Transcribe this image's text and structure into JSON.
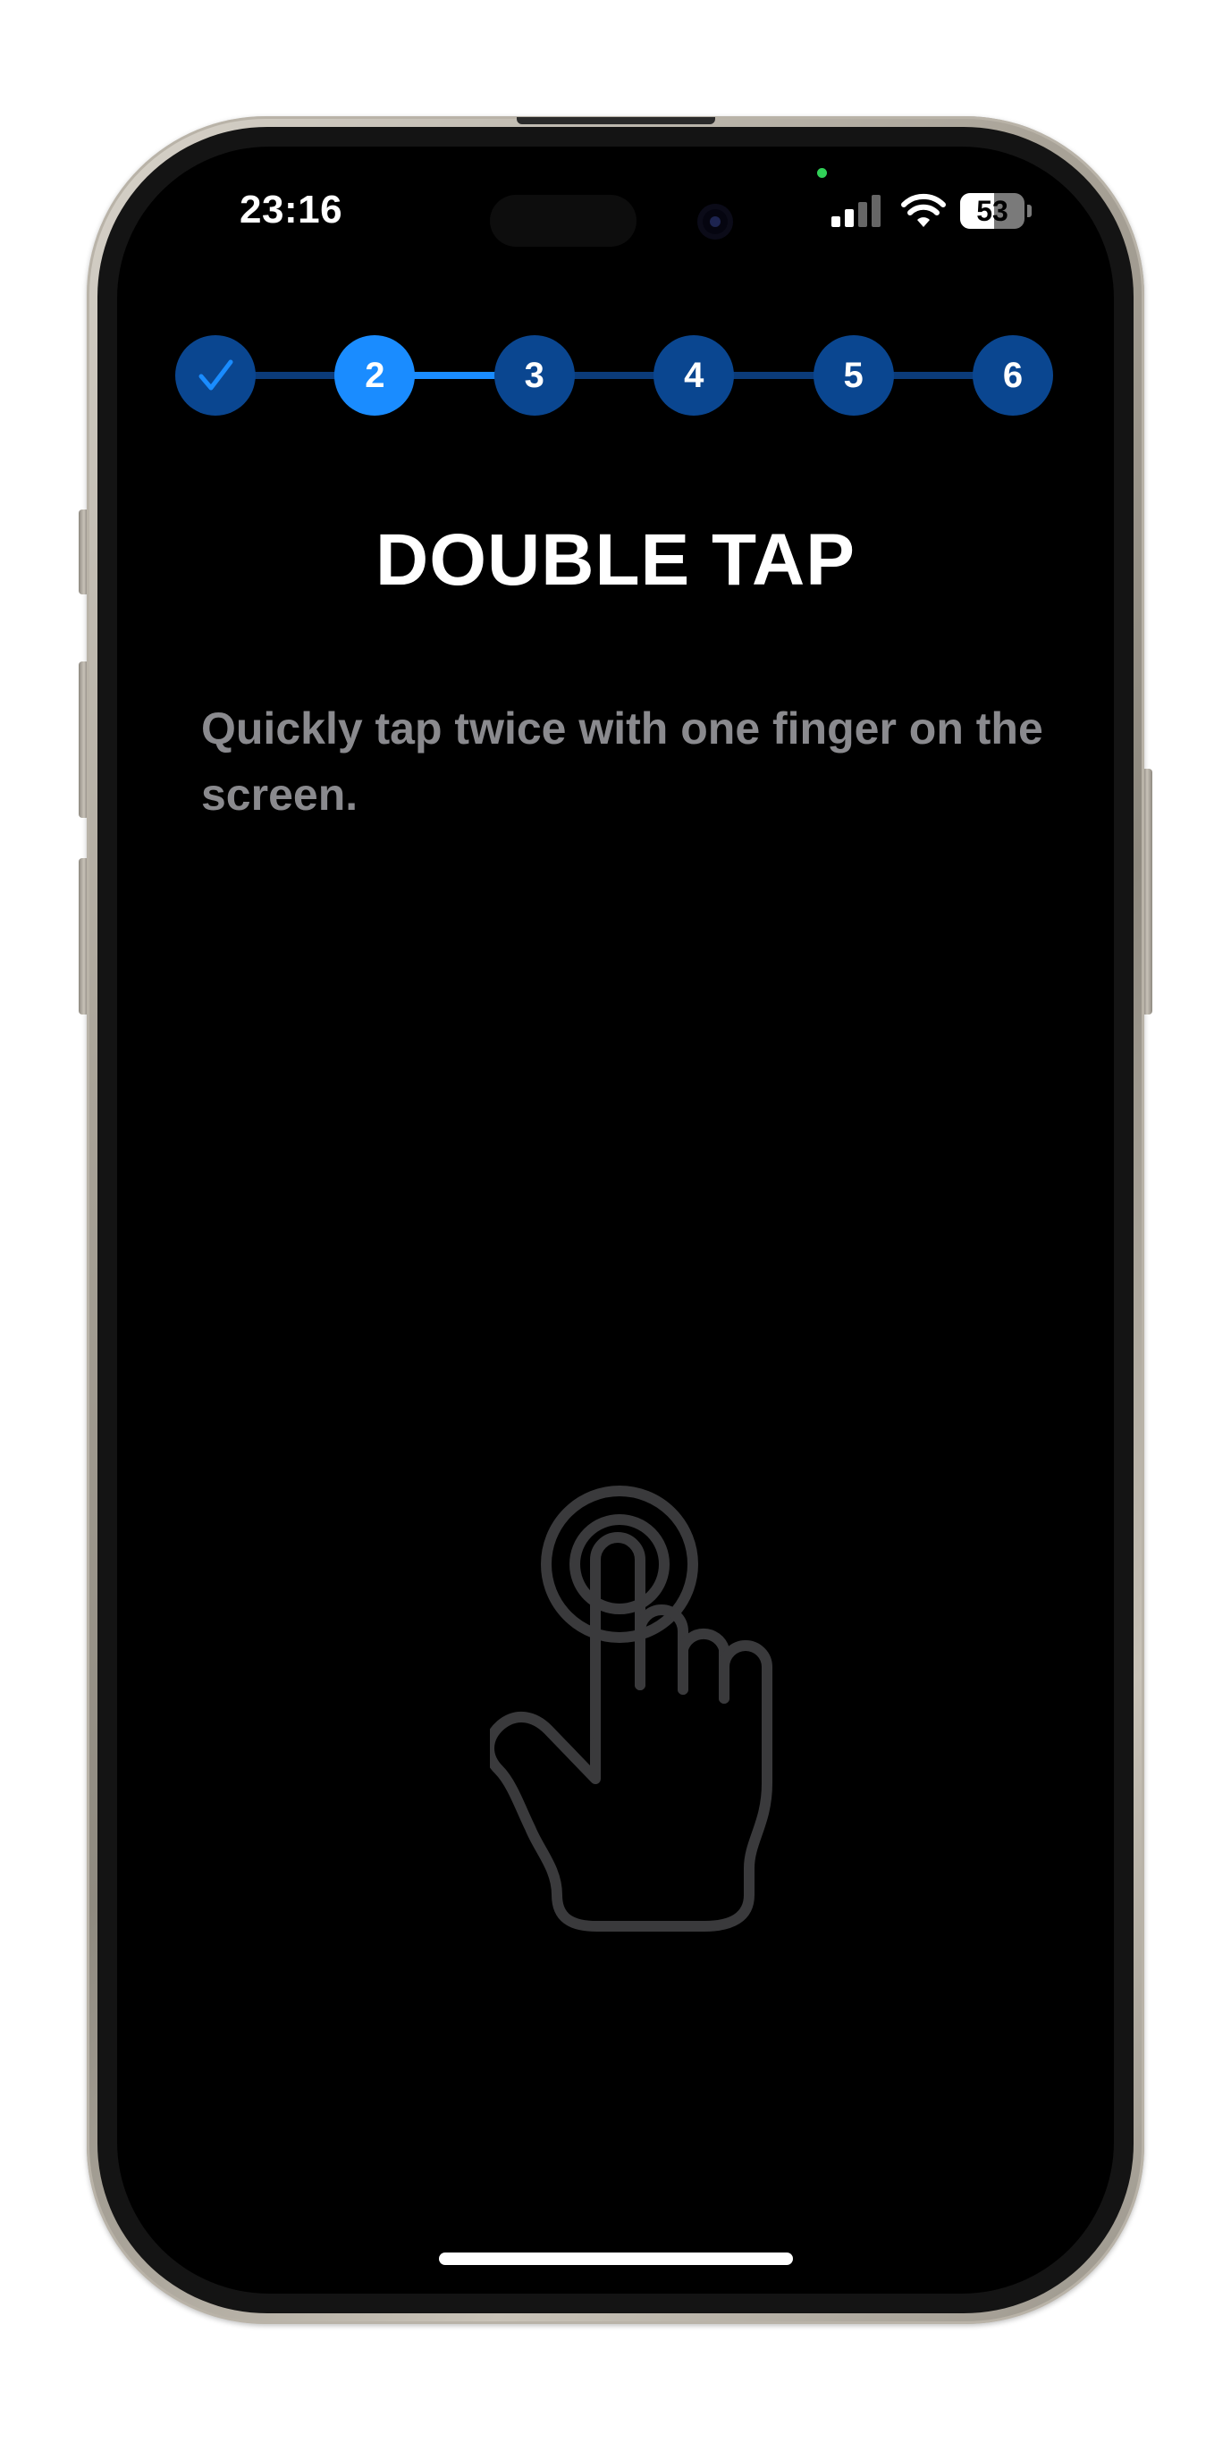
{
  "status_bar": {
    "time": "23:16",
    "battery_level": "53",
    "battery_fraction": 0.53,
    "privacy_indicator_color": "#31d158"
  },
  "stepper": {
    "steps": [
      {
        "label": "",
        "state": "done",
        "icon": "checkmark-icon"
      },
      {
        "label": "2",
        "state": "current"
      },
      {
        "label": "3",
        "state": "upcoming"
      },
      {
        "label": "4",
        "state": "upcoming"
      },
      {
        "label": "5",
        "state": "upcoming"
      },
      {
        "label": "6",
        "state": "upcoming"
      }
    ],
    "active_color": "#1a8cff",
    "inactive_color": "#0a4690"
  },
  "main": {
    "title": "DOUBLE TAP",
    "instruction": "Quickly tap twice with one finger on the screen.",
    "gesture_icon": "double-tap-hand-icon"
  }
}
